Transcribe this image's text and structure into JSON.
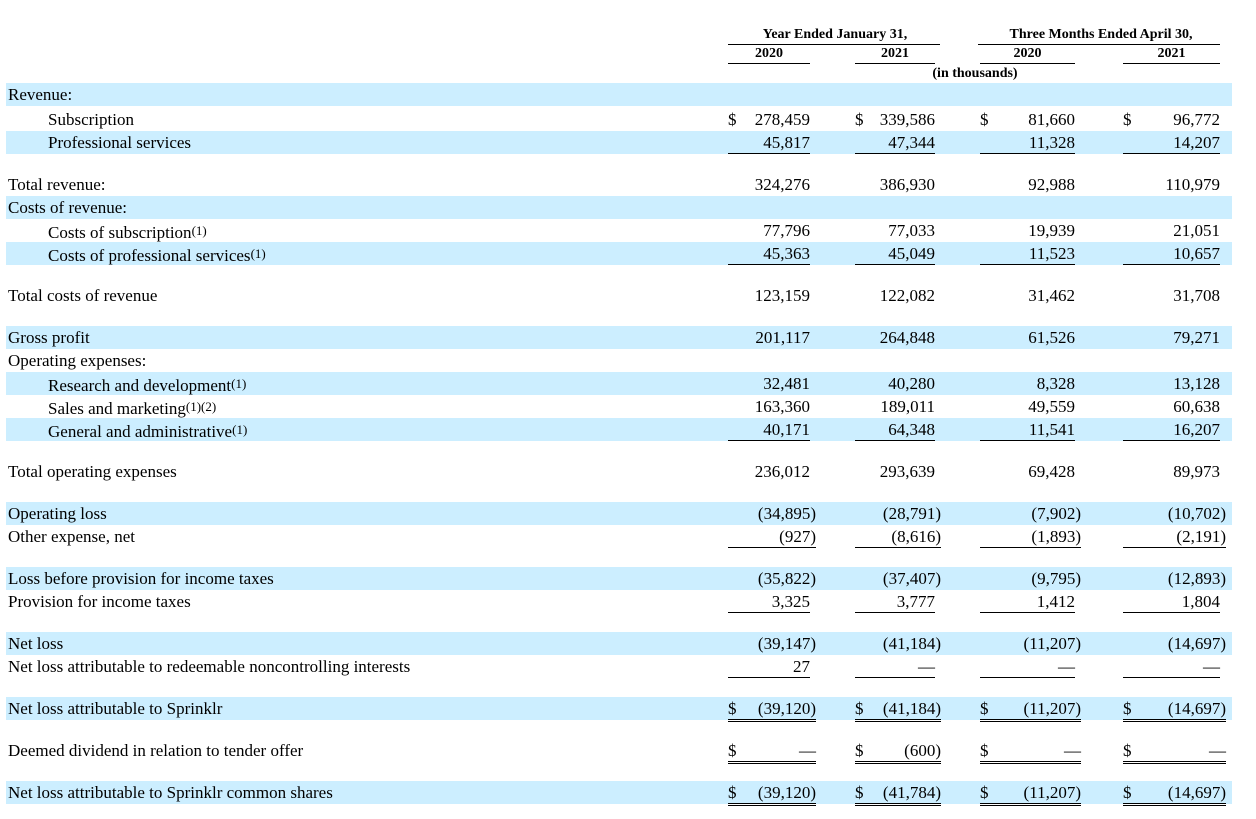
{
  "header": {
    "year_group": "Year Ended January 31,",
    "quarter_group": "Three Months Ended April 30,",
    "col_years": [
      "2020",
      "2021",
      "2020",
      "2021"
    ],
    "units": "(in thousands)"
  },
  "rows": [
    {
      "label": "Revenue:",
      "values": [
        "",
        "",
        "",
        ""
      ],
      "shade": true
    },
    {
      "label": "Subscription",
      "values": [
        "278,459",
        "339,586",
        "81,660",
        "96,772"
      ],
      "dollar": [
        true,
        true,
        true,
        true
      ],
      "shade": false
    },
    {
      "label": "Professional services",
      "values": [
        "45,817",
        "47,344",
        "11,328",
        "14,207"
      ],
      "shade": true
    },
    {
      "label": "Total revenue:",
      "values": [
        "324,276",
        "386,930",
        "92,988",
        "110,979"
      ],
      "shade": false
    },
    {
      "label": "Costs of revenue:",
      "values": [
        "",
        "",
        "",
        ""
      ],
      "shade": true
    },
    {
      "label": "Costs of subscription",
      "sup": "(1)",
      "values": [
        "77,796",
        "77,033",
        "19,939",
        "21,051"
      ],
      "shade": false
    },
    {
      "label": "Costs of professional services",
      "sup": "(1)",
      "values": [
        "45,363",
        "45,049",
        "11,523",
        "10,657"
      ],
      "shade": true
    },
    {
      "label": "Total costs of revenue",
      "values": [
        "123,159",
        "122,082",
        "31,462",
        "31,708"
      ],
      "shade": false
    },
    {
      "label": "Gross profit",
      "values": [
        "201,117",
        "264,848",
        "61,526",
        "79,271"
      ],
      "shade": true
    },
    {
      "label": "Operating expenses:",
      "values": [
        "",
        "",
        "",
        ""
      ],
      "shade": false
    },
    {
      "label": "Research and development",
      "sup": "(1)",
      "values": [
        "32,481",
        "40,280",
        "8,328",
        "13,128"
      ],
      "shade": true
    },
    {
      "label": "Sales and marketing",
      "sup": "(1)(2)",
      "values": [
        "163,360",
        "189,011",
        "49,559",
        "60,638"
      ],
      "shade": false
    },
    {
      "label": "General and administrative",
      "sup": "(1)",
      "values": [
        "40,171",
        "64,348",
        "11,541",
        "16,207"
      ],
      "shade": true
    },
    {
      "label": "Total operating expenses",
      "values": [
        "236,012",
        "293,639",
        "69,428",
        "89,973"
      ],
      "shade": false
    },
    {
      "label": "Operating loss",
      "values": [
        "(34,895)",
        "(28,791)",
        "(7,902)",
        "(10,702)"
      ],
      "shade": true
    },
    {
      "label": "Other expense, net",
      "values": [
        "(927)",
        "(8,616)",
        "(1,893)",
        "(2,191)"
      ],
      "shade": false
    },
    {
      "label": "Loss before provision for income taxes",
      "values": [
        "(35,822)",
        "(37,407)",
        "(9,795)",
        "(12,893)"
      ],
      "shade": true
    },
    {
      "label": "Provision for income taxes",
      "values": [
        "3,325",
        "3,777",
        "1,412",
        "1,804"
      ],
      "shade": false
    },
    {
      "label": "Net loss",
      "values": [
        "(39,147)",
        "(41,184)",
        "(11,207)",
        "(14,697)"
      ],
      "shade": true
    },
    {
      "label": "Net loss attributable to redeemable noncontrolling interests",
      "values": [
        "27",
        "—",
        "—",
        "—"
      ],
      "shade": false
    },
    {
      "label": "Net loss attributable to Sprinklr",
      "values": [
        "(39,120)",
        "(41,184)",
        "(11,207)",
        "(14,697)"
      ],
      "dollar": [
        true,
        true,
        true,
        true
      ],
      "shade": true
    },
    {
      "label": "Deemed dividend in relation to tender offer",
      "values": [
        "—",
        "(600)",
        "—",
        "—"
      ],
      "dollar": [
        true,
        true,
        true,
        true
      ],
      "shade": false
    },
    {
      "label": "Net loss attributable to Sprinklr common shares",
      "values": [
        "(39,120)",
        "(41,784)",
        "(11,207)",
        "(14,697)"
      ],
      "dollar": [
        true,
        true,
        true,
        true
      ],
      "shade": true
    }
  ],
  "currency_symbol": "$"
}
